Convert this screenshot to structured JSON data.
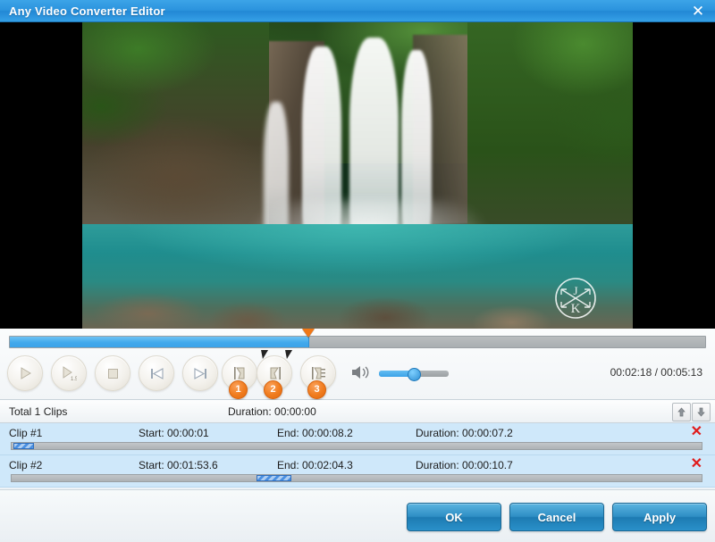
{
  "window": {
    "title": "Any Video Converter Editor",
    "close_label": "✕"
  },
  "player": {
    "seek_percent": 43,
    "clip_markers_percent": [
      36.5,
      40
    ],
    "time_display": "00:02:18 / 00:05:13",
    "current_time": "00:02:18",
    "total_time": "00:05:13",
    "volume_percent": 44,
    "buttons": [
      {
        "name": "play-button",
        "icon": "play-icon",
        "label": "Play"
      },
      {
        "name": "play-speed-button",
        "icon": "play-1.5x-icon",
        "label": "Play 1.5x"
      },
      {
        "name": "stop-button",
        "icon": "stop-icon",
        "label": "Stop"
      },
      {
        "name": "previous-frame-button",
        "icon": "skip-backward-icon",
        "label": "Previous"
      },
      {
        "name": "next-frame-button",
        "icon": "skip-forward-icon",
        "label": "Next"
      },
      {
        "name": "set-start-button",
        "icon": "set-start-icon",
        "label": "Set Start",
        "badge": "1"
      },
      {
        "name": "set-end-button",
        "icon": "set-end-icon",
        "label": "Set End",
        "badge": "2"
      },
      {
        "name": "add-clip-button",
        "icon": "add-clip-icon",
        "label": "Add Clip",
        "badge": "3"
      }
    ],
    "volume_icon": "speaker-icon"
  },
  "clip_header": {
    "total_label": "Total 1 Clips",
    "duration_label": "Duration: 00:00:00",
    "move_up_label": "Move Up",
    "move_down_label": "Move Down"
  },
  "clips": [
    {
      "name": "Clip #1",
      "start": "Start: 00:00:01",
      "end": "End: 00:00:08.2",
      "duration": "Duration: 00:00:07.2",
      "delete_label": "✕",
      "segment_left_percent": 0.3,
      "segment_width_percent": 3.0
    },
    {
      "name": "Clip #2",
      "start": "Start: 00:01:53.6",
      "end": "End: 00:02:04.3",
      "duration": "Duration: 00:00:10.7",
      "delete_label": "✕",
      "segment_left_percent": 35.5,
      "segment_width_percent": 5.0
    }
  ],
  "footer": {
    "ok_label": "OK",
    "cancel_label": "Cancel",
    "apply_label": "Apply"
  },
  "colors": {
    "titlebar_blue": "#2b93dd",
    "accent_orange": "#f07818",
    "seek_blue": "#41a9ec",
    "row_blue": "#cfe8fa",
    "delete_red": "#e01b1b",
    "button_blue": "#2e8ec4"
  },
  "video": {
    "watermark": "JK"
  }
}
